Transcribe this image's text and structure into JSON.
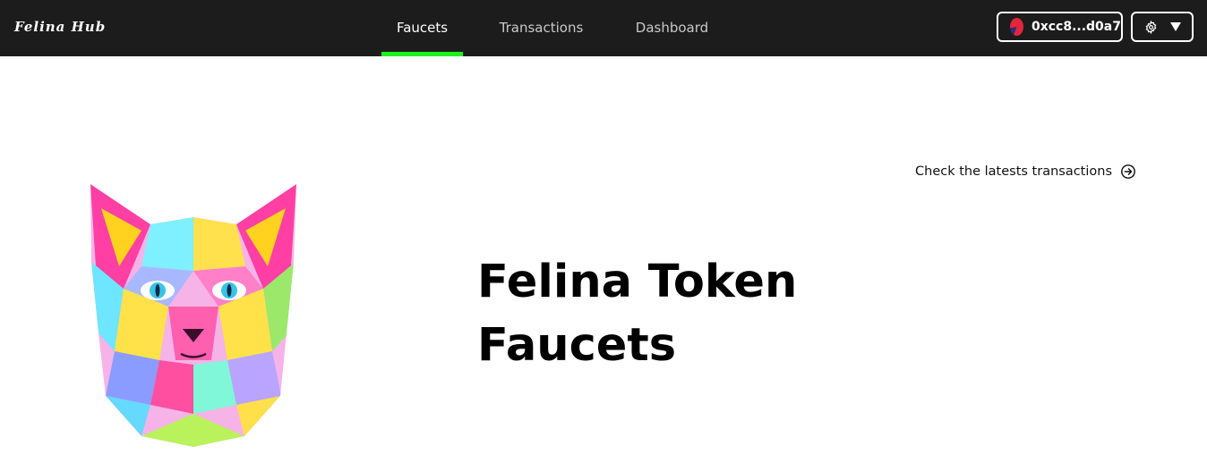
{
  "header": {
    "logo": "Felina Hub",
    "tabs": [
      {
        "label": "Faucets",
        "active": true
      },
      {
        "label": "Transactions",
        "active": false
      },
      {
        "label": "Dashboard",
        "active": false
      }
    ],
    "wallet": {
      "address": "0xcc8...d0a7",
      "avatar_icon": "wallet-avatar-icon"
    },
    "settings": {
      "icon": "gear-icon",
      "dropdown_icon": "caret-down-icon"
    }
  },
  "main": {
    "link_text": "Check the latests transactions",
    "link_icon": "arrow-circle-right-icon",
    "title_line1": "Felina Token",
    "title_line2": "Faucets",
    "image_icon": "polygonal-cat-illustration"
  },
  "colors": {
    "topbar": "#1c1c1c",
    "accent": "#1eef1e",
    "text": "#000000"
  }
}
